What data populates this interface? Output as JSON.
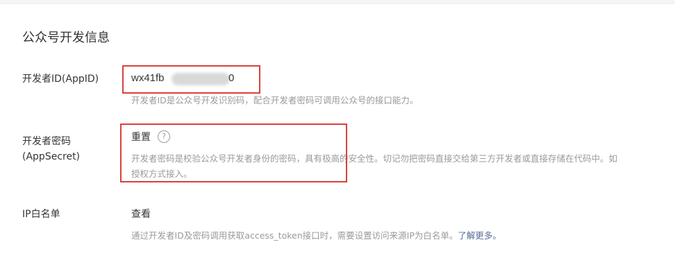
{
  "section": {
    "title": "公众号开发信息"
  },
  "appid": {
    "label": "开发者ID(AppID)",
    "value_prefix": "wx41fb",
    "value_suffix": "0",
    "description": "开发者ID是公众号开发识别码，配合开发者密码可调用公众号的接口能力。"
  },
  "appsecret": {
    "label": "开发者密码(AppSecret)",
    "reset_label": "重置",
    "help_icon": "?",
    "description_line1": "开发者密码是校验公众号开发者身份的密码，具有极高的安全性。切记勿把密码直接交给第三方开发者或直接存储在代码中。如",
    "description_line2": "授权方式接入。"
  },
  "ip_whitelist": {
    "label": "IP白名单",
    "view_label": "查看",
    "description": "通过开发者ID及密码调用获取access_token接口时，需要设置访问来源IP为白名单。",
    "learn_more": "了解更多。"
  },
  "colors": {
    "highlight": "#d9403d",
    "link": "#576b95",
    "muted_text": "#9a9a9a"
  }
}
